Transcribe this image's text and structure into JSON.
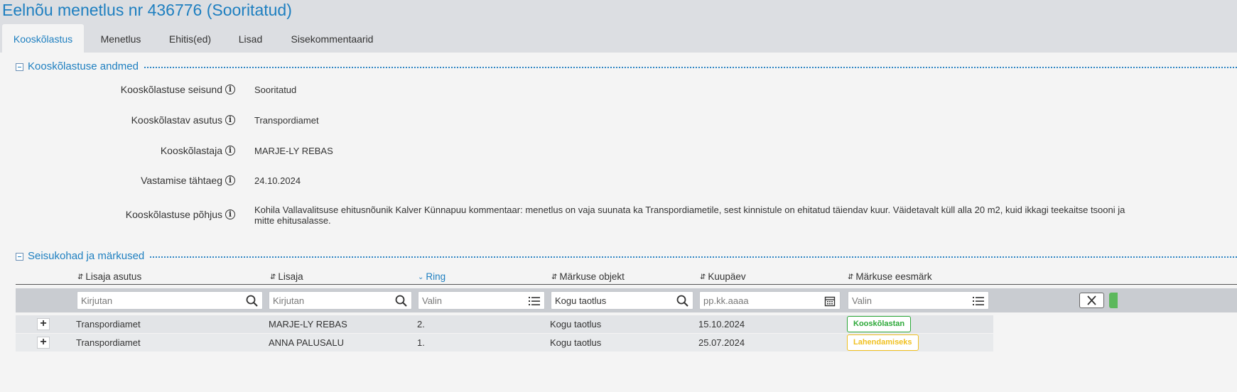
{
  "page": {
    "title": "Eelnõu menetlus nr 436776 (Sooritatud)"
  },
  "tabs": [
    {
      "label": "Kooskõlastus",
      "active": true
    },
    {
      "label": "Menetlus"
    },
    {
      "label": "Ehitis(ed)"
    },
    {
      "label": "Lisad"
    },
    {
      "label": "Sisekommentaarid"
    }
  ],
  "approval_section": {
    "title": "Kooskõlastuse andmed",
    "fields": [
      {
        "label": "Kooskõlastuse seisund",
        "value": "Sooritatud"
      },
      {
        "label": "Kooskõlastav asutus",
        "value": "Transpordiamet"
      },
      {
        "label": "Kooskõlastaja",
        "value": "MARJE-LY REBAS"
      },
      {
        "label": "Vastamise tähtaeg",
        "value": "24.10.2024"
      },
      {
        "label": "Kooskõlastuse põhjus",
        "value_line1": "Kohila Vallavalitsuse ehitusnõunik Kalver Künnapuu kommentaar: menetlus on vaja suunata ka Transpordiametile, sest kinnistule on ehitatud täiendav kuur. Väidetavalt küll alla 20 m2, kuid ikkagi teekaitse tsooni ja",
        "value_line2": "mitte ehitusalasse."
      }
    ]
  },
  "remarks_section": {
    "title": "Seisukohad ja märkused",
    "columns": [
      "Lisaja asutus",
      "Lisaja",
      "Ring",
      "Märkuse objekt",
      "Kuupäev",
      "Märkuse eesmärk"
    ],
    "sorted_column": "Ring",
    "filters": {
      "agency": {
        "placeholder": "Kirjutan",
        "value": ""
      },
      "author": {
        "placeholder": "Kirjutan",
        "value": ""
      },
      "round": {
        "placeholder": "Valin",
        "value": ""
      },
      "object": {
        "placeholder": "Kirjutan",
        "value": "Kogu taotlus"
      },
      "date": {
        "placeholder": "pp.kk.aaaa",
        "value": ""
      },
      "purpose": {
        "placeholder": "Valin",
        "value": ""
      }
    },
    "rows": [
      {
        "agency": "Transpordiamet",
        "author": "MARJE-LY REBAS",
        "round": "2.",
        "object": "Kogu taotlus",
        "date": "15.10.2024",
        "purpose": "Kooskõlastan"
      },
      {
        "agency": "Transpordiamet",
        "author": "ANNA PALUSALU",
        "round": "1.",
        "object": "Kogu taotlus",
        "date": "25.07.2024",
        "purpose": "Lahendamiseks"
      }
    ]
  },
  "colors": {
    "accent": "#1e7fc0",
    "badge_green": "#2ca838",
    "badge_yellow": "#f0c020",
    "button_green": "#5cb85c"
  }
}
